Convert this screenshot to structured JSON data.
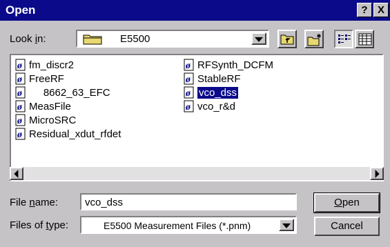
{
  "window": {
    "title": "Open",
    "help_label": "?",
    "close_label": "X"
  },
  "lookin": {
    "label_prefix": "Look ",
    "label_key": "i",
    "label_suffix": "n:",
    "value": "E5500"
  },
  "files": [
    {
      "name": "fm_discr2",
      "selected": false
    },
    {
      "name": "FreeRF",
      "selected": false
    },
    {
      "name": "     8662_63_EFC",
      "selected": false
    },
    {
      "name": "MeasFile",
      "selected": false
    },
    {
      "name": "MicroSRC",
      "selected": false
    },
    {
      "name": "Residual_xdut_rfdet",
      "selected": false
    },
    {
      "name": "RFSynth_DCFM",
      "selected": false
    },
    {
      "name": "StableRF",
      "selected": false
    },
    {
      "name": "vco_dss",
      "selected": true
    },
    {
      "name": "vco_r&d",
      "selected": false
    }
  ],
  "filename": {
    "label_prefix": "File ",
    "label_key": "n",
    "label_suffix": "ame:",
    "value": "vco_dss"
  },
  "filetype": {
    "label_prefix": "Files of ",
    "label_key": "t",
    "label_suffix": "ype:",
    "value": "E5500 Measurement Files (*.pnm)"
  },
  "buttons": {
    "open_key": "O",
    "open_rest": "pen",
    "cancel": "Cancel"
  },
  "colors": {
    "titlebar": "#0a0a8a",
    "face": "#c6c3c6",
    "selection": "#0a0a8a",
    "folder": "#e8d870"
  },
  "icons": {
    "folder": "folder-icon",
    "up": "up-folder-icon",
    "new_folder": "new-folder-icon",
    "list_view": "list-view-icon",
    "details_view": "details-view-icon",
    "file": "file-icon"
  }
}
